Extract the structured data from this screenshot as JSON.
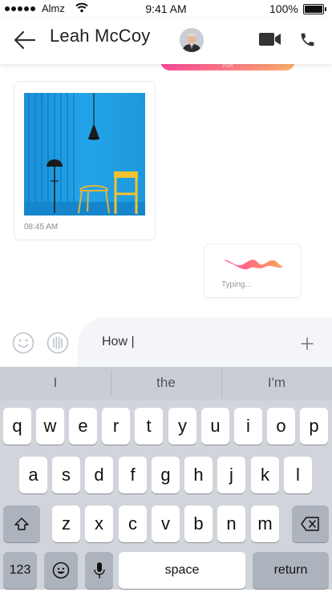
{
  "status_bar": {
    "carrier": "Almz",
    "time": "9:41 AM",
    "battery": "100%"
  },
  "header": {
    "contact_name": "Leah McCoy"
  },
  "chat": {
    "sent_time": "AM",
    "image_message_time": "08:45 AM",
    "typing_label": "Typing..."
  },
  "input": {
    "value": "How |"
  },
  "keyboard": {
    "suggestions": [
      "I",
      "the",
      "I'm"
    ],
    "row1": [
      "q",
      "w",
      "e",
      "r",
      "t",
      "y",
      "u",
      "i",
      "o",
      "p"
    ],
    "row2": [
      "a",
      "s",
      "d",
      "f",
      "g",
      "h",
      "j",
      "k",
      "l"
    ],
    "row3": [
      "z",
      "x",
      "c",
      "v",
      "b",
      "n",
      "m"
    ],
    "numbers_label": "123",
    "space_label": "space",
    "return_label": "return"
  },
  "colors": {
    "accent_gradient_start": "#ff4a9a",
    "accent_gradient_end": "#ffb26a"
  }
}
